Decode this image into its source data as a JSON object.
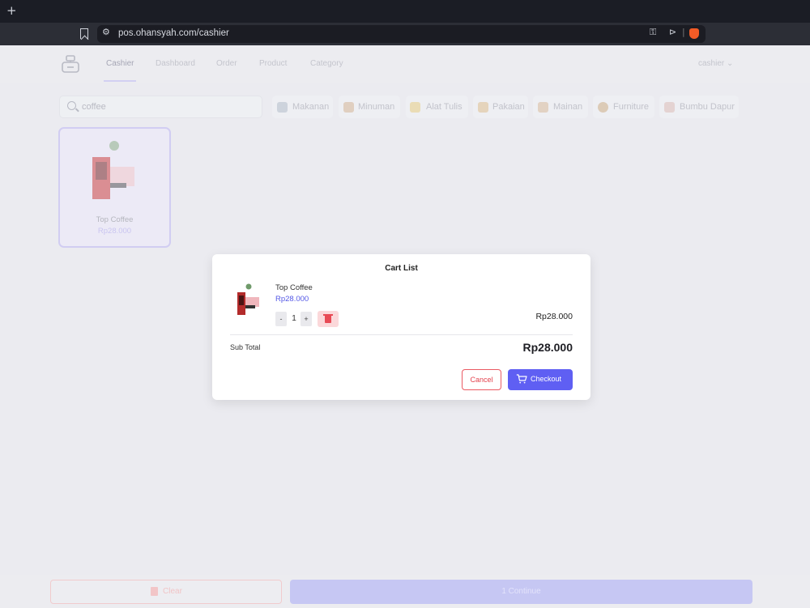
{
  "browser": {
    "new_tab_glyph": "+",
    "url": "pos.ohansyah.com/cashier",
    "icons": [
      "bookmark-icon",
      "site-settings-icon",
      "key-icon",
      "send-icon",
      "brave-shield-icon"
    ]
  },
  "header": {
    "nav": [
      "Cashier",
      "Dashboard",
      "Order",
      "Product",
      "Category"
    ],
    "active_nav": "Cashier",
    "user": "cashier"
  },
  "search": {
    "value": "coffee"
  },
  "categories": [
    "Makanan",
    "Minuman",
    "Alat Tulis",
    "Pakaian",
    "Mainan",
    "Furniture",
    "Bumbu Dapur"
  ],
  "products": [
    {
      "name": "Top Coffee",
      "price": "Rp28.000"
    }
  ],
  "cart_modal": {
    "title": "Cart List",
    "items": [
      {
        "name": "Top Coffee",
        "price": "Rp28.000",
        "qty": "1",
        "line_total": "Rp28.000"
      }
    ],
    "qty_minus": "-",
    "qty_plus": "+",
    "subtotal_label": "Sub Total",
    "subtotal_value": "Rp28.000",
    "cancel_label": "Cancel",
    "checkout_label": "Checkout"
  },
  "bottom": {
    "clear_label": "Clear",
    "continue_label": "1 Continue"
  },
  "colors": {
    "accent": "#5f5ff3",
    "danger": "#e4424d",
    "price": "#5458e6"
  }
}
